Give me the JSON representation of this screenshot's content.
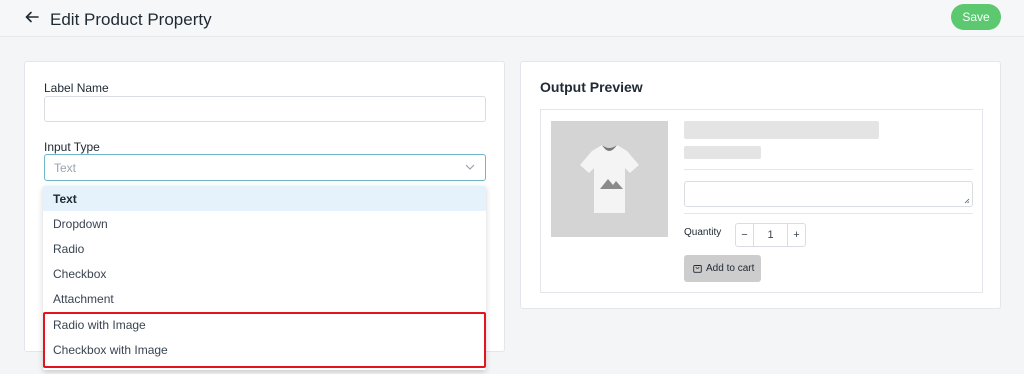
{
  "header": {
    "title": "Edit Product Property",
    "save_label": "Save"
  },
  "form": {
    "label_name": {
      "label": "Label Name",
      "value": ""
    },
    "input_type": {
      "label": "Input Type",
      "selected": "Text",
      "options": [
        "Text",
        "Dropdown",
        "Radio",
        "Checkbox",
        "Attachment",
        "Radio with Image",
        "Checkbox with Image"
      ],
      "highlighted_options": [
        "Radio with Image",
        "Checkbox with Image"
      ]
    }
  },
  "preview": {
    "title": "Output Preview",
    "quantity_label": "Quantity",
    "quantity_value": "1",
    "minus": "−",
    "plus": "+",
    "add_to_cart": "Add to cart"
  },
  "colors": {
    "accent_save": "#5cc870",
    "select_border": "#6fb6c8",
    "highlight_box": "#e3141e",
    "active_option_bg": "#e5f1fb"
  },
  "icons": {
    "back": "arrow-left-icon",
    "chevron": "chevron-down-icon",
    "product_image": "tshirt-placeholder-icon",
    "cart": "cart-bag-icon"
  }
}
